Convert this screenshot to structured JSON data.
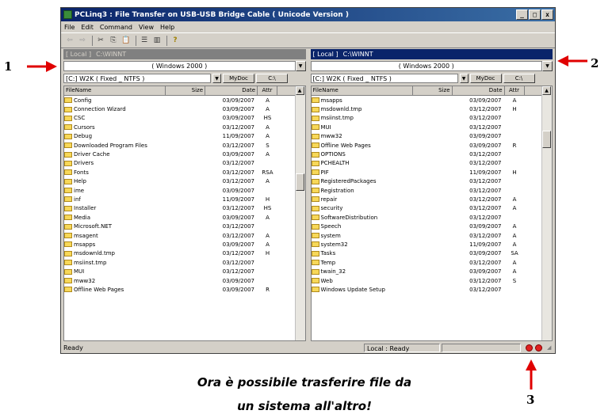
{
  "window": {
    "title": "PCLinq3 : File Transfer on USB-USB Bridge Cable ( Unicode Version )",
    "buttons": [
      "_",
      "□",
      "x"
    ]
  },
  "menu": [
    "File",
    "Edit",
    "Command",
    "View",
    "Help"
  ],
  "toolbar_icons": [
    "back-icon",
    "forward-icon",
    "cut-icon",
    "copy-icon",
    "paste-icon",
    "list-view-icon",
    "details-view-icon",
    "help-icon"
  ],
  "toolbar_glyphs": [
    "⇦",
    "⇨",
    "✂",
    "⎘",
    "📋",
    "☰",
    "▥",
    "?"
  ],
  "left": {
    "path_tag": "[ Local ]",
    "path": "C:\\WINNT",
    "os": "( Windows 2000 )",
    "drive": "[C:] W2K ( Fixed _ NTFS )",
    "mydoc": "MyDoc",
    "root": "C:\\",
    "columns": [
      "FileName",
      "Size",
      "Date",
      "Attr"
    ],
    "files": [
      {
        "name": "Config",
        "date": "03/09/2007",
        "attr": "A"
      },
      {
        "name": "Connection Wizard",
        "date": "03/09/2007",
        "attr": "A"
      },
      {
        "name": "CSC",
        "date": "03/09/2007",
        "attr": "HS"
      },
      {
        "name": "Cursors",
        "date": "03/12/2007",
        "attr": "A"
      },
      {
        "name": "Debug",
        "date": "11/09/2007",
        "attr": "A"
      },
      {
        "name": "Downloaded Program Files",
        "date": "03/12/2007",
        "attr": "S"
      },
      {
        "name": "Driver Cache",
        "date": "03/09/2007",
        "attr": "A"
      },
      {
        "name": "Drivers",
        "date": "03/12/2007",
        "attr": ""
      },
      {
        "name": "Fonts",
        "date": "03/12/2007",
        "attr": "RSA"
      },
      {
        "name": "Help",
        "date": "03/12/2007",
        "attr": "A"
      },
      {
        "name": "ime",
        "date": "03/09/2007",
        "attr": ""
      },
      {
        "name": "inf",
        "date": "11/09/2007",
        "attr": "H"
      },
      {
        "name": "Installer",
        "date": "03/12/2007",
        "attr": "HS"
      },
      {
        "name": "Media",
        "date": "03/09/2007",
        "attr": "A"
      },
      {
        "name": "Microsoft.NET",
        "date": "03/12/2007",
        "attr": ""
      },
      {
        "name": "msagent",
        "date": "03/12/2007",
        "attr": "A"
      },
      {
        "name": "msapps",
        "date": "03/09/2007",
        "attr": "A"
      },
      {
        "name": "msdownld.tmp",
        "date": "03/12/2007",
        "attr": "H"
      },
      {
        "name": "msiinst.tmp",
        "date": "03/12/2007",
        "attr": ""
      },
      {
        "name": "MUI",
        "date": "03/12/2007",
        "attr": ""
      },
      {
        "name": "mww32",
        "date": "03/09/2007",
        "attr": ""
      },
      {
        "name": "Offline Web Pages",
        "date": "03/09/2007",
        "attr": "R"
      }
    ]
  },
  "right": {
    "path_tag": "[ Local ]",
    "path": "C:\\WINNT",
    "os": "( Windows 2000 )",
    "drive": "[C:] W2K ( Fixed _ NTFS )",
    "mydoc": "MyDoc",
    "root": "C:\\",
    "columns": [
      "FileName",
      "Size",
      "Date",
      "Attr"
    ],
    "files": [
      {
        "name": "msapps",
        "date": "03/09/2007",
        "attr": "A"
      },
      {
        "name": "msdownld.tmp",
        "date": "03/12/2007",
        "attr": "H"
      },
      {
        "name": "msiinst.tmp",
        "date": "03/12/2007",
        "attr": ""
      },
      {
        "name": "MUI",
        "date": "03/12/2007",
        "attr": ""
      },
      {
        "name": "mww32",
        "date": "03/09/2007",
        "attr": ""
      },
      {
        "name": "Offline Web Pages",
        "date": "03/09/2007",
        "attr": "R"
      },
      {
        "name": "OPTIONS",
        "date": "03/12/2007",
        "attr": ""
      },
      {
        "name": "PCHEALTH",
        "date": "03/12/2007",
        "attr": ""
      },
      {
        "name": "PIF",
        "date": "11/09/2007",
        "attr": "H"
      },
      {
        "name": "RegisteredPackages",
        "date": "03/12/2007",
        "attr": ""
      },
      {
        "name": "Registration",
        "date": "03/12/2007",
        "attr": ""
      },
      {
        "name": "repair",
        "date": "03/12/2007",
        "attr": "A"
      },
      {
        "name": "security",
        "date": "03/12/2007",
        "attr": "A"
      },
      {
        "name": "SoftwareDistribution",
        "date": "03/12/2007",
        "attr": ""
      },
      {
        "name": "Speech",
        "date": "03/09/2007",
        "attr": "A"
      },
      {
        "name": "system",
        "date": "03/12/2007",
        "attr": "A"
      },
      {
        "name": "system32",
        "date": "11/09/2007",
        "attr": "A"
      },
      {
        "name": "Tasks",
        "date": "03/09/2007",
        "attr": "SA"
      },
      {
        "name": "Temp",
        "date": "03/12/2007",
        "attr": "A"
      },
      {
        "name": "twain_32",
        "date": "03/09/2007",
        "attr": "A"
      },
      {
        "name": "Web",
        "date": "03/12/2007",
        "attr": "S"
      },
      {
        "name": "Windows Update Setup",
        "date": "03/12/2007",
        "attr": ""
      }
    ]
  },
  "status": {
    "left": "Ready",
    "middle": "Local : Ready"
  },
  "callouts": {
    "one": "1",
    "two": "2",
    "three": "3"
  },
  "caption": {
    "line1": "Ora è possibile trasferire file da",
    "line2": "un sistema all'altro!"
  },
  "colors": {
    "arrow": "#e00000",
    "titlebar": "#0a246a",
    "active_path": "#0a246a"
  }
}
